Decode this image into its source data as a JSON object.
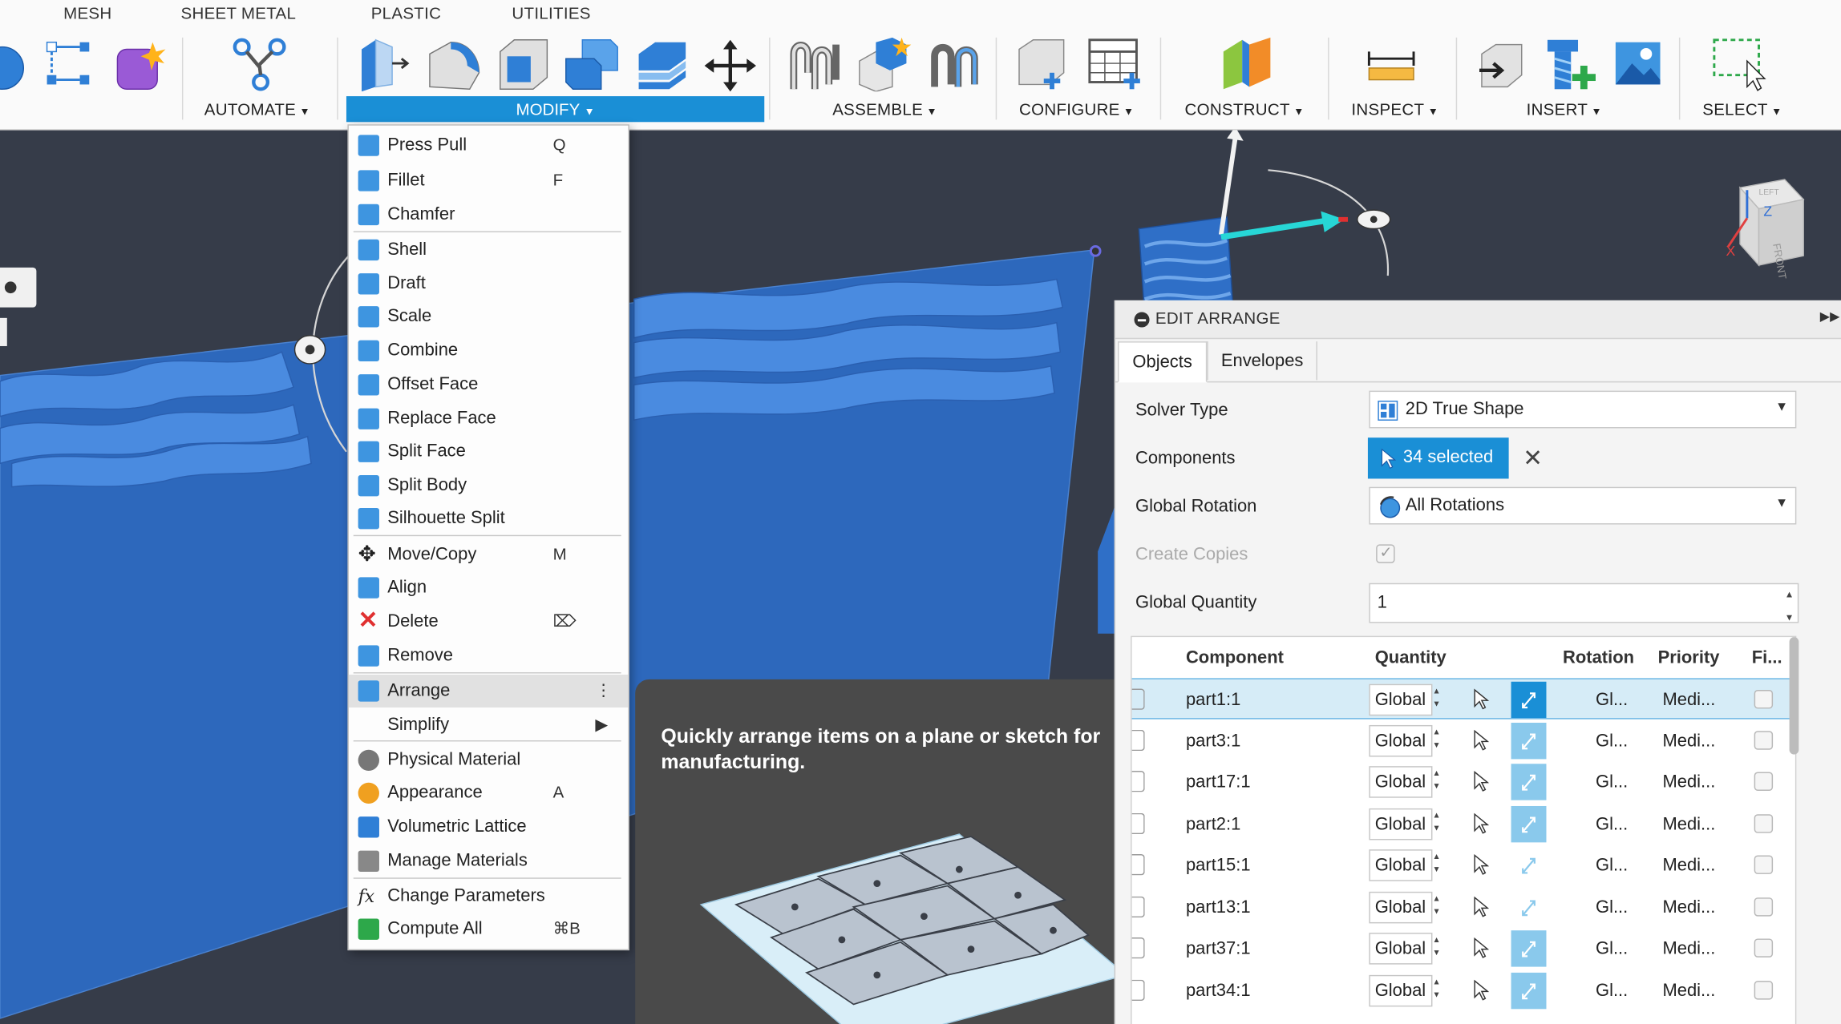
{
  "workspace_tabs": [
    "MESH",
    "SHEET METAL",
    "PLASTIC",
    "UTILITIES"
  ],
  "toolbar_groups": {
    "automate": "AUTOMATE",
    "modify": "MODIFY",
    "assemble": "ASSEMBLE",
    "configure": "CONFIGURE",
    "construct": "CONSTRUCT",
    "inspect": "INSPECT",
    "insert": "INSERT",
    "select": "SELECT"
  },
  "modify_menu": [
    {
      "label": "Press Pull",
      "shortcut": "Q",
      "icon": "press-pull-icon"
    },
    {
      "label": "Fillet",
      "shortcut": "F",
      "icon": "fillet-icon"
    },
    {
      "label": "Chamfer",
      "shortcut": "",
      "icon": "chamfer-icon"
    },
    {
      "label": "Shell",
      "shortcut": "",
      "icon": "shell-icon"
    },
    {
      "label": "Draft",
      "shortcut": "",
      "icon": "draft-icon"
    },
    {
      "label": "Scale",
      "shortcut": "",
      "icon": "scale-icon"
    },
    {
      "label": "Combine",
      "shortcut": "",
      "icon": "combine-icon"
    },
    {
      "label": "Offset Face",
      "shortcut": "",
      "icon": "offset-face-icon"
    },
    {
      "label": "Replace Face",
      "shortcut": "",
      "icon": "replace-face-icon"
    },
    {
      "label": "Split Face",
      "shortcut": "",
      "icon": "split-face-icon"
    },
    {
      "label": "Split Body",
      "shortcut": "",
      "icon": "split-body-icon"
    },
    {
      "label": "Silhouette Split",
      "shortcut": "",
      "icon": "silhouette-split-icon"
    },
    {
      "label": "Move/Copy",
      "shortcut": "M",
      "icon": "move-copy-icon"
    },
    {
      "label": "Align",
      "shortcut": "",
      "icon": "align-icon"
    },
    {
      "label": "Delete",
      "shortcut": "⌦",
      "icon": "delete-icon"
    },
    {
      "label": "Remove",
      "shortcut": "",
      "icon": "remove-icon"
    },
    {
      "label": "Arrange",
      "shortcut": "⋮",
      "icon": "arrange-icon"
    },
    {
      "label": "Simplify",
      "shortcut": "▶",
      "icon": ""
    },
    {
      "label": "Physical Material",
      "shortcut": "",
      "icon": "physical-material-icon"
    },
    {
      "label": "Appearance",
      "shortcut": "A",
      "icon": "appearance-icon"
    },
    {
      "label": "Volumetric Lattice",
      "shortcut": "",
      "icon": "volumetric-lattice-icon"
    },
    {
      "label": "Manage Materials",
      "shortcut": "",
      "icon": "manage-materials-icon"
    },
    {
      "label": "Change Parameters",
      "shortcut": "",
      "icon": "change-parameters-icon"
    },
    {
      "label": "Compute All",
      "shortcut": "⌘B",
      "icon": "compute-all-icon"
    }
  ],
  "tooltip": {
    "text": "Quickly arrange items on a plane or sketch for manufacturing."
  },
  "panel": {
    "title": "EDIT ARRANGE",
    "tabs": [
      "Objects",
      "Envelopes"
    ],
    "solver_type_label": "Solver Type",
    "solver_type_value": "2D True Shape",
    "components_label": "Components",
    "components_value": "34 selected",
    "global_rotation_label": "Global Rotation",
    "global_rotation_value": "All Rotations",
    "create_copies_label": "Create Copies",
    "global_quantity_label": "Global Quantity",
    "global_quantity_value": "1",
    "table_headers": {
      "component": "Component",
      "quantity": "Quantity",
      "rotation": "Rotation",
      "priority": "Priority",
      "fixed": "Fi..."
    },
    "rows": [
      {
        "name": "part1:1",
        "qty": "Global",
        "rotation": "Gl...",
        "priority": "Medi..."
      },
      {
        "name": "part3:1",
        "qty": "Global",
        "rotation": "Gl...",
        "priority": "Medi..."
      },
      {
        "name": "part17:1",
        "qty": "Global",
        "rotation": "Gl...",
        "priority": "Medi..."
      },
      {
        "name": "part2:1",
        "qty": "Global",
        "rotation": "Gl...",
        "priority": "Medi..."
      },
      {
        "name": "part15:1",
        "qty": "Global",
        "rotation": "Gl...",
        "priority": "Medi..."
      },
      {
        "name": "part13:1",
        "qty": "Global",
        "rotation": "Gl...",
        "priority": "Medi..."
      },
      {
        "name": "part37:1",
        "qty": "Global",
        "rotation": "Gl...",
        "priority": "Medi..."
      },
      {
        "name": "part34:1",
        "qty": "Global",
        "rotation": "Gl...",
        "priority": "Medi..."
      }
    ]
  },
  "viewcube": {
    "top": "LEFT",
    "front": "FRONT",
    "axis_z": "Z",
    "axis_x": "X"
  },
  "colors": {
    "accent": "#1a8fd6",
    "sheet": "#2f6fc1",
    "viewport": "#363c49"
  }
}
